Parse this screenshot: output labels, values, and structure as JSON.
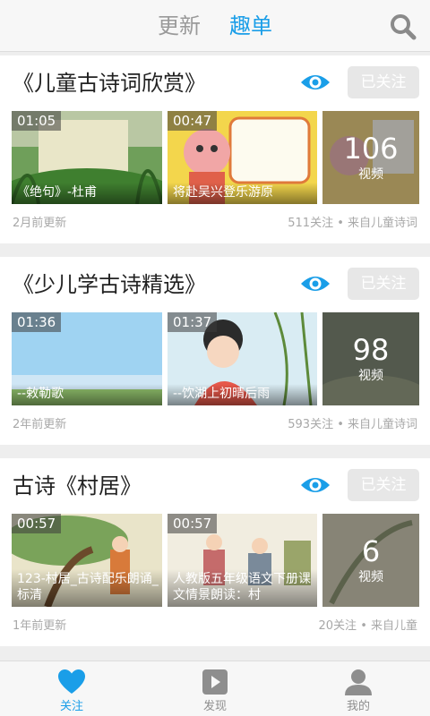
{
  "header": {
    "tabs": [
      {
        "label": "更新",
        "active": false
      },
      {
        "label": "趣单",
        "active": true
      }
    ],
    "search_icon": "search-icon",
    "accent_color": "#1a9ee8"
  },
  "cards": [
    {
      "title": "《儿童古诗词欣赏》",
      "follow_label": "已关注",
      "videos": [
        {
          "duration": "01:05",
          "title": "《绝句》-杜甫"
        },
        {
          "duration": "00:47",
          "title": "将赴吴兴登乐游原"
        }
      ],
      "count": "106",
      "count_label": "视频",
      "updated": "2月前更新",
      "stats": "511关注 • 来自儿童诗词"
    },
    {
      "title": "《少儿学古诗精选》",
      "follow_label": "已关注",
      "videos": [
        {
          "duration": "01:36",
          "title": "--敕勒歌"
        },
        {
          "duration": "01:37",
          "title": "--饮湖上初晴后雨"
        }
      ],
      "count": "98",
      "count_label": "视频",
      "updated": "2年前更新",
      "stats": "593关注 • 来自儿童诗词"
    },
    {
      "title": "古诗《村居》",
      "follow_label": "已关注",
      "videos": [
        {
          "duration": "00:57",
          "title": "123-村居_古诗配乐朗诵_标清"
        },
        {
          "duration": "00:57",
          "title": "人教版五年级语文下册课文情景朗读：村"
        }
      ],
      "count": "6",
      "count_label": "视频",
      "updated": "1年前更新",
      "stats": "20关注 • 来自儿童"
    }
  ],
  "bottom_nav": [
    {
      "label": "关注",
      "icon": "heart-icon",
      "active": true
    },
    {
      "label": "发现",
      "icon": "play-icon",
      "active": false
    },
    {
      "label": "我的",
      "icon": "person-icon",
      "active": false
    }
  ]
}
